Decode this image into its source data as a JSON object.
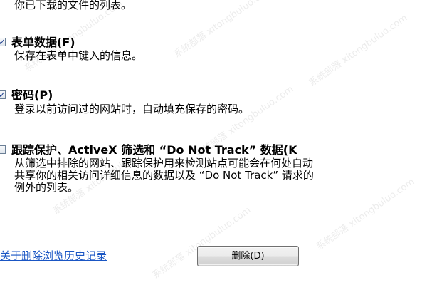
{
  "top_description": "你已下载的文件的列表。",
  "options": [
    {
      "title": "表单数据(F)",
      "checked": true,
      "description_lines": [
        "保存在表单中键入的信息。"
      ]
    },
    {
      "title": "密码(P)",
      "checked": true,
      "description_lines": [
        "登录以前访问过的网站时，自动填充保存的密码。"
      ]
    },
    {
      "title": "跟踪保护、ActiveX 筛选和 “Do Not Track” 数据(K",
      "checked": false,
      "description_lines": [
        "从筛选中排除的网站、跟踪保护用来检测站点可能会在何处自动",
        "共享你的相关访问详细信息的数据以及 “Do Not Track” 请求的",
        "例外的列表。"
      ]
    }
  ],
  "link_text": "关于删除浏览历史记录",
  "delete_button_label": "删除(D)",
  "watermark_text": "系统部落 xitongbuluo.com",
  "colors": {
    "link": "#1a56c4",
    "checkbox_border": "#6b7f96",
    "check_mark": "#1a3b8c"
  }
}
